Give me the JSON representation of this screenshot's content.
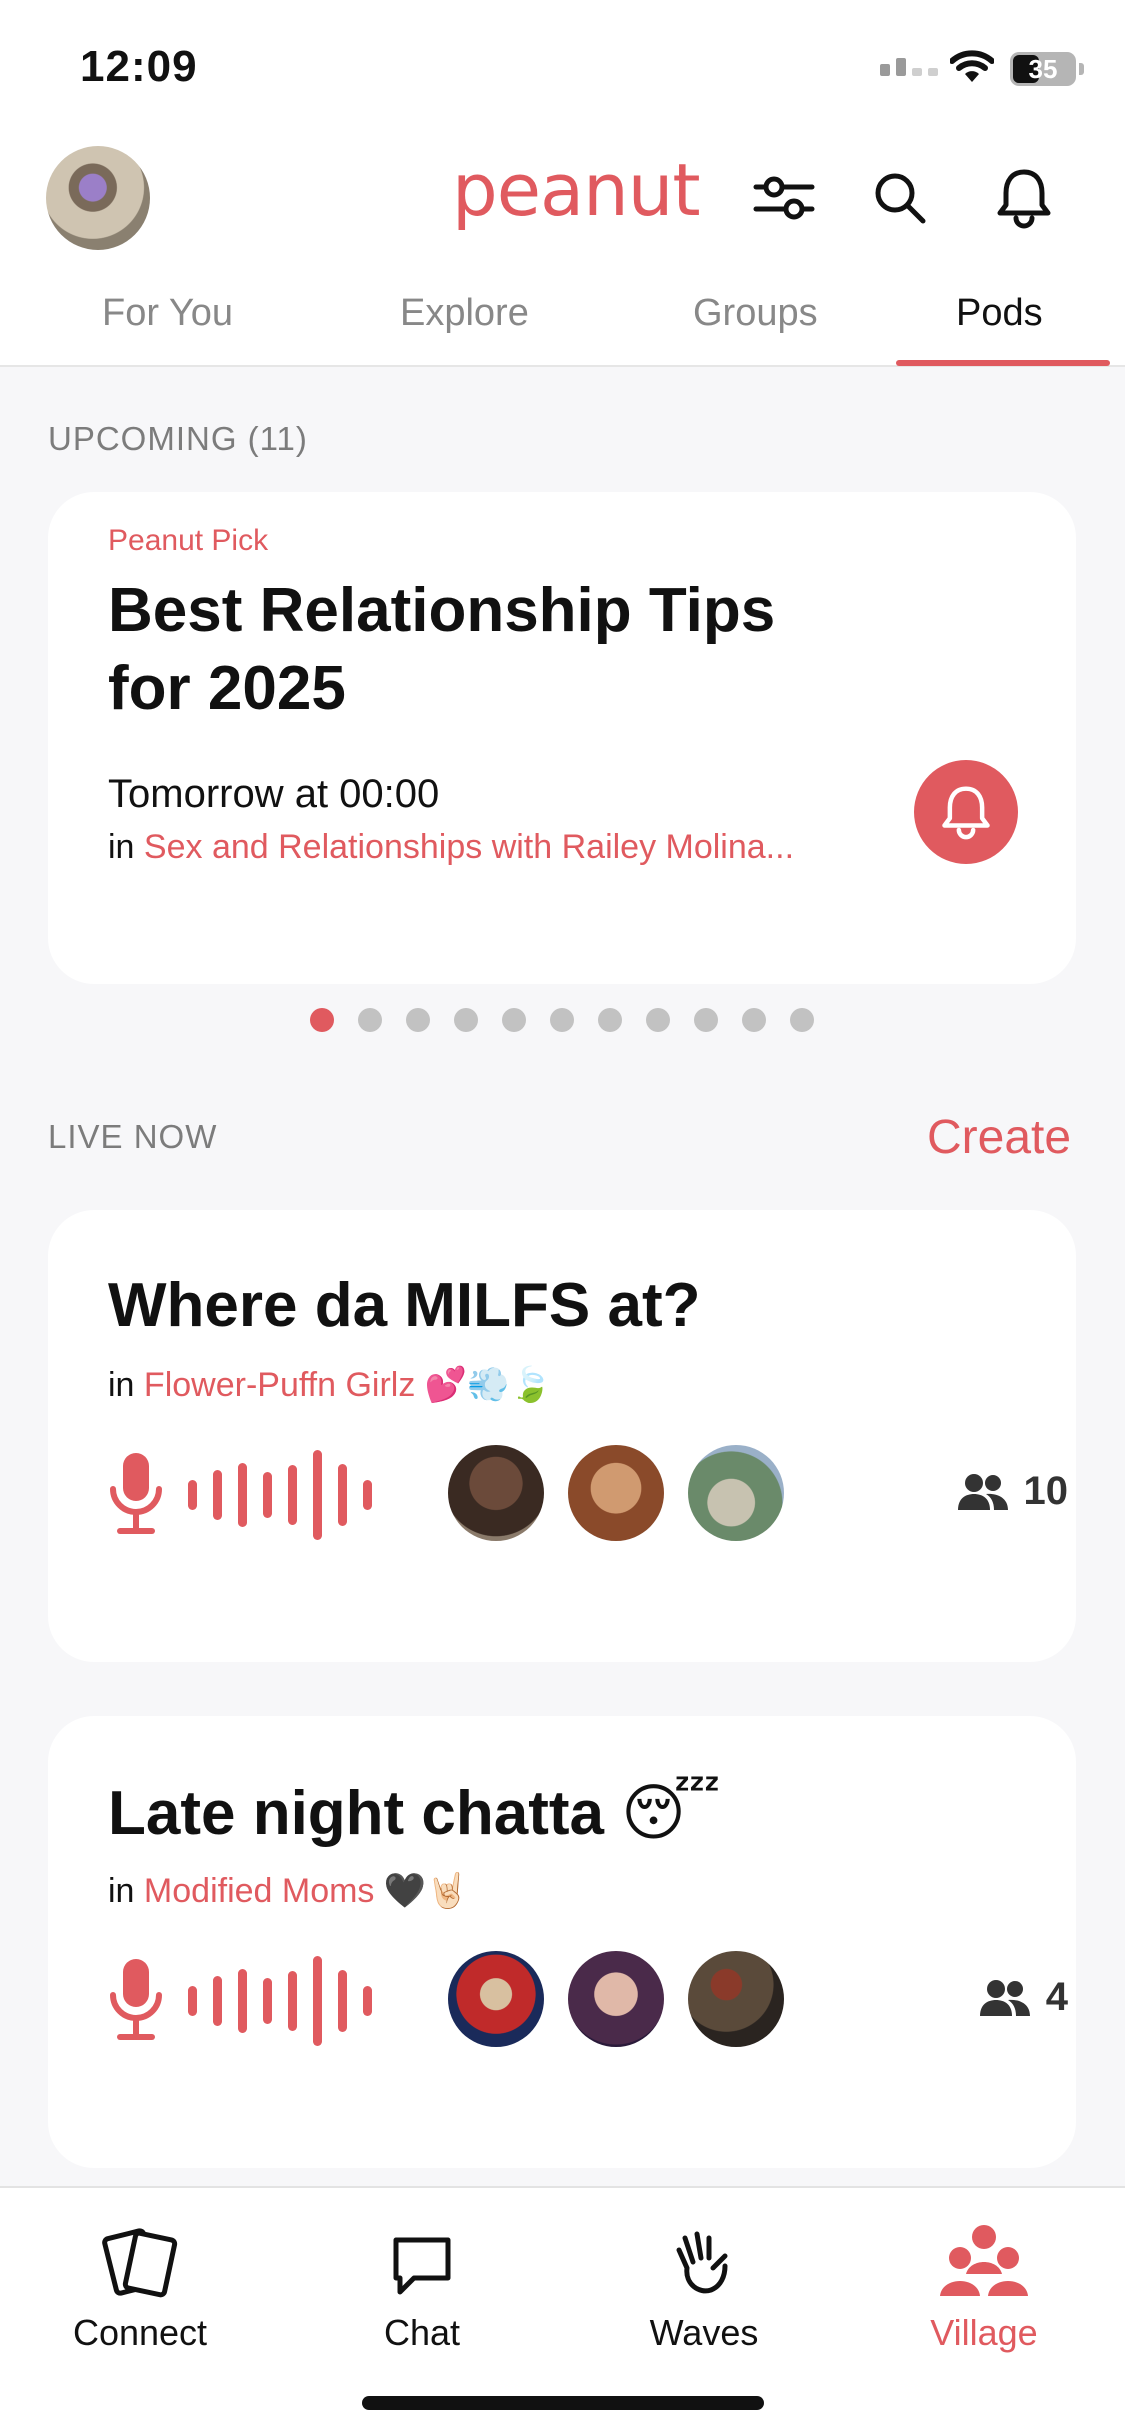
{
  "status": {
    "time": "12:09",
    "battery": "35"
  },
  "header": {
    "logo": "peanut",
    "icons": [
      "sliders-icon",
      "search-icon",
      "bell-icon"
    ]
  },
  "tabs": [
    {
      "label": "For You"
    },
    {
      "label": "Explore"
    },
    {
      "label": "Groups"
    },
    {
      "label": "Pods",
      "active": true
    }
  ],
  "upcoming": {
    "label": "UPCOMING (11)",
    "card": {
      "pick_label": "Peanut Pick",
      "title": "Best Relationship Tips for 2025",
      "time": "Tomorrow at 00:00",
      "in_prefix": "in ",
      "group": "Sex and Relationships with Railey Molina..."
    },
    "page_count": 11,
    "active_page": 1
  },
  "live": {
    "label": "LIVE NOW",
    "create": "Create",
    "pods": [
      {
        "title": "Where da MILFS at?",
        "in_prefix": "in ",
        "group": "Flower-Puffn Girlz 💕💨🍃",
        "count": "10"
      },
      {
        "title": "Late night chatta 😴",
        "in_prefix": "in ",
        "group": "Modified Moms 🖤🤘🏻",
        "count": "4"
      }
    ]
  },
  "bottom_nav": [
    {
      "label": "Connect",
      "icon": "cards-icon"
    },
    {
      "label": "Chat",
      "icon": "chat-bubble-icon"
    },
    {
      "label": "Waves",
      "icon": "waving-hand-icon"
    },
    {
      "label": "Village",
      "icon": "group-people-icon",
      "active": true
    }
  ],
  "colors": {
    "accent": "#e05a5f",
    "background": "#f7f7f9",
    "card": "#ffffff"
  }
}
